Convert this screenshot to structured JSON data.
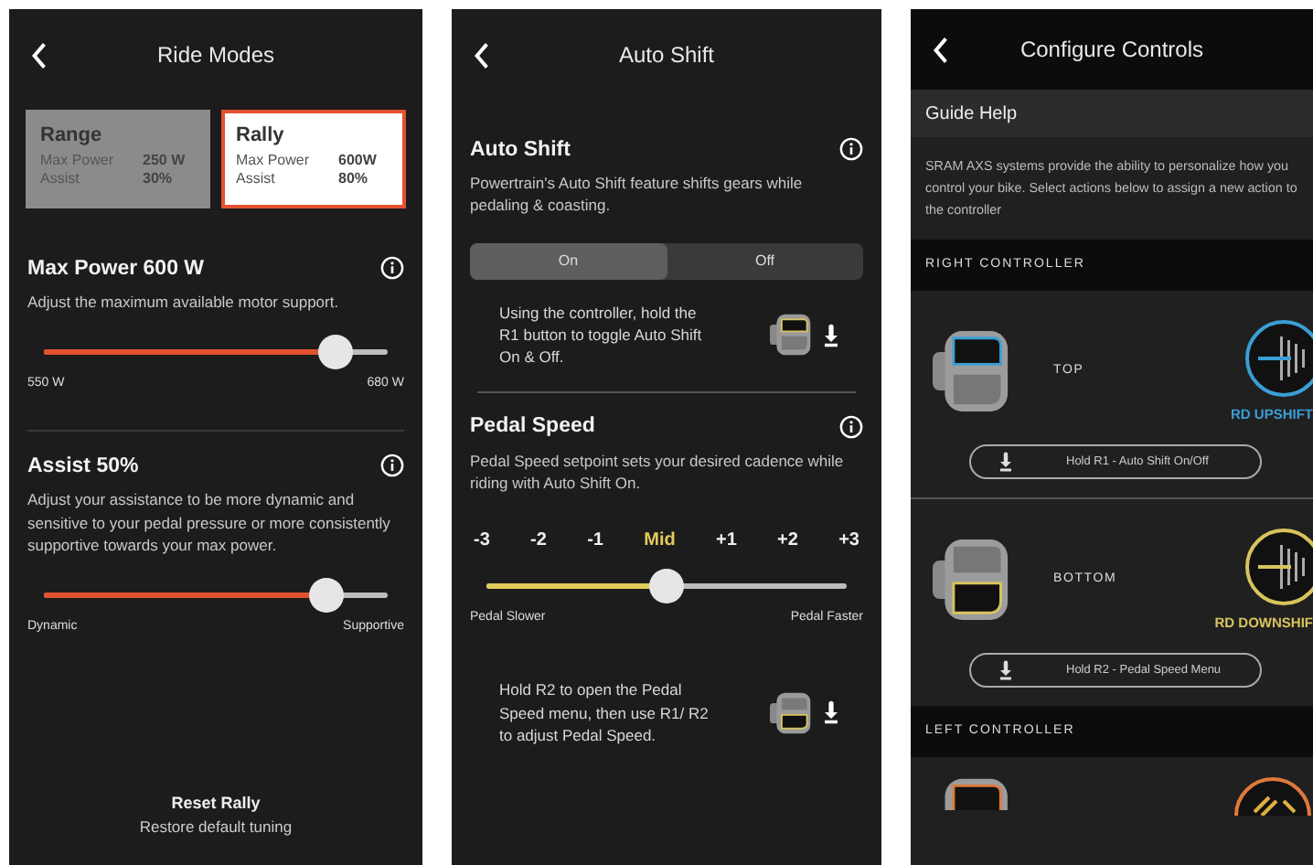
{
  "ride_modes": {
    "title": "Ride Modes",
    "modes": [
      {
        "name": "Range",
        "max_power_label": "Max Power",
        "max_power": "250 W",
        "assist_label": "Assist",
        "assist": "30%",
        "selected": false
      },
      {
        "name": "Rally",
        "max_power_label": "Max Power",
        "max_power": "600W",
        "assist_label": "Assist",
        "assist": "80%",
        "selected": true
      }
    ],
    "sliders": [
      {
        "title": "Max Power 600 W",
        "description": "Adjust the maximum available motor support.",
        "level": 0.85,
        "min_label": "550 W",
        "max_label": "680 W"
      },
      {
        "title": "Assist 50%",
        "description": "Adjust your assistance to be more dynamic and sensitive to your pedal pressure or more consistently supportive towards your max power.",
        "level": 0.82,
        "min_label": "Dynamic",
        "max_label": "Supportive"
      }
    ],
    "reset": {
      "title": "Reset Rally",
      "subtitle": "Restore default tuning"
    }
  },
  "auto_shift": {
    "title": "Auto Shift",
    "section": {
      "title": "Auto Shift",
      "description": "Powertrain's Auto Shift feature shifts gears while pedaling & coasting.",
      "options": [
        {
          "label": "On",
          "selected": true
        },
        {
          "label": "Off",
          "selected": false
        }
      ],
      "hint": "Using the controller, hold the R1 button to toggle Auto Shift On & Off.",
      "kind": "top"
    },
    "pedal_speed": {
      "title": "Pedal Speed",
      "description": "Pedal Speed setpoint sets your desired cadence while riding with Auto Shift On.",
      "steps": [
        {
          "label": "-3",
          "selected": false
        },
        {
          "label": "-2",
          "selected": false
        },
        {
          "label": "-1",
          "selected": false
        },
        {
          "label": "Mid",
          "selected": true
        },
        {
          "label": "+1",
          "selected": false
        },
        {
          "label": "+2",
          "selected": false
        },
        {
          "label": "+3",
          "selected": false
        }
      ],
      "level": 0.5,
      "min_label": "Pedal Slower",
      "max_label": "Pedal Faster",
      "hint": "Hold R2 to open the Pedal Speed menu, then use R1/ R2 to adjust Pedal Speed.",
      "kind": "bottom"
    }
  },
  "configure": {
    "title": "Configure Controls",
    "guide_help": "Guide Help",
    "description": "SRAM AXS systems provide the ability to personalize how you control your bike. Select actions below to assign a new action to the controller",
    "sections": [
      {
        "header": "RIGHT CONTROLLER",
        "controls": [
          {
            "position": "TOP",
            "kind": "top",
            "action": "RD UPSHIFT",
            "color": "#3a9fd6",
            "hint": "Hold R1 - Auto Shift On/Off"
          },
          {
            "position": "BOTTOM",
            "kind": "bottom",
            "action": "RD DOWNSHIF",
            "color": "#d9c45c",
            "hint": "Hold R2 - Pedal Speed Menu"
          }
        ]
      },
      {
        "header": "LEFT CONTROLLER"
      }
    ]
  }
}
